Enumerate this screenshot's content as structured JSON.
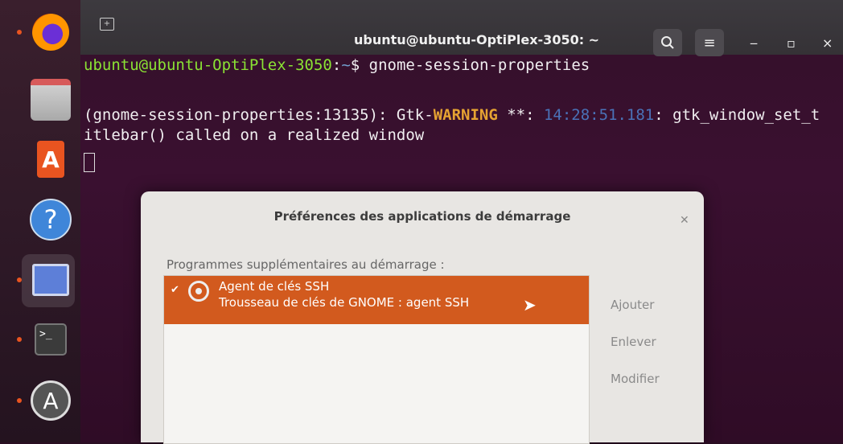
{
  "dock": {
    "items": [
      {
        "name": "firefox"
      },
      {
        "name": "files"
      },
      {
        "name": "software"
      },
      {
        "name": "help",
        "glyph": "?"
      },
      {
        "name": "settings"
      },
      {
        "name": "terminal",
        "glyph": ">_"
      },
      {
        "name": "updater",
        "glyph": "A"
      }
    ]
  },
  "terminal": {
    "title": "ubuntu@ubuntu-OptiPlex-3050: ~",
    "prompt_user": "ubuntu@ubuntu-OptiPlex-3050",
    "prompt_sep": ":",
    "prompt_path": "~",
    "prompt_symbol": "$",
    "command": "gnome-session-properties",
    "warn_prefix": "(gnome-session-properties:13135): Gtk-",
    "warn_word": "WARNING",
    "warn_stars": " **: ",
    "warn_time": "14:28:51.181",
    "warn_rest": ": gtk_window_set_t",
    "warn_line2": "itlebar() called on a realized window"
  },
  "dialog": {
    "title": "Préférences des applications de démarrage",
    "section_label": "Programmes supplémentaires au démarrage :",
    "programs": [
      {
        "name": "Agent de clés SSH",
        "description": "Trousseau de clés de GNOME : agent SSH",
        "checked": true
      }
    ],
    "buttons": {
      "add": "Ajouter",
      "remove": "Enlever",
      "edit": "Modifier"
    }
  },
  "colors": {
    "accent": "#e95420",
    "selected_row": "#d25a1e",
    "terminal_bg": "#3a1030"
  }
}
